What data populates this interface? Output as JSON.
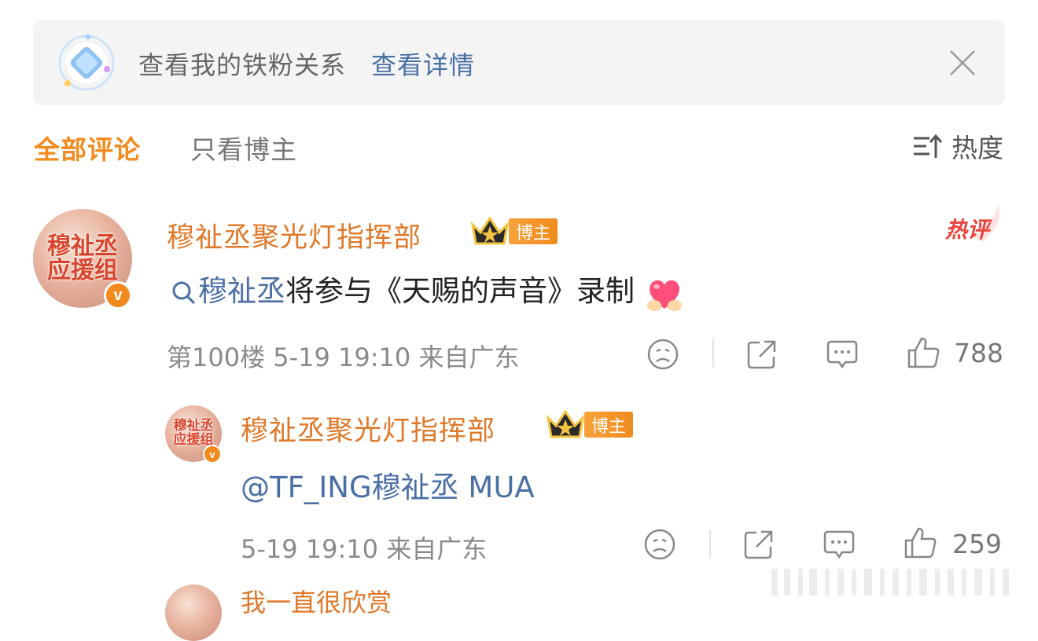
{
  "banner": {
    "text": "查看我的铁粉关系",
    "link": "查看详情"
  },
  "tabs": {
    "all": "全部评论",
    "author_only": "只看博主",
    "sort": "热度"
  },
  "comment": {
    "username": "穆祉丞聚光灯指挥部",
    "badge": "博主",
    "avatar_text": "穆祉丞应援组",
    "hot_tag": "热评",
    "topic": "穆祉丞",
    "text": "将参与《天赐的声音》录制",
    "meta": "第100楼  5-19 19:10  来自广东",
    "likes": "788"
  },
  "reply": {
    "username": "穆祉丞聚光灯指挥部",
    "badge": "博主",
    "avatar_text": "穆祉丞应援组",
    "text": "@TF_ING穆祉丞 MUA",
    "meta": "5-19 19:10  来自广东",
    "likes": "259"
  },
  "next_comment_peek": "我一直很欣赏",
  "colors": {
    "accent": "#f28a1e",
    "link": "#4a6fa5",
    "username": "#e0782a"
  },
  "icons": [
    "diamond-icon",
    "close-icon",
    "sort-icon",
    "crown-icon",
    "search-icon",
    "heart-hands-icon",
    "dislike-icon",
    "share-icon",
    "comment-icon",
    "like-icon"
  ]
}
